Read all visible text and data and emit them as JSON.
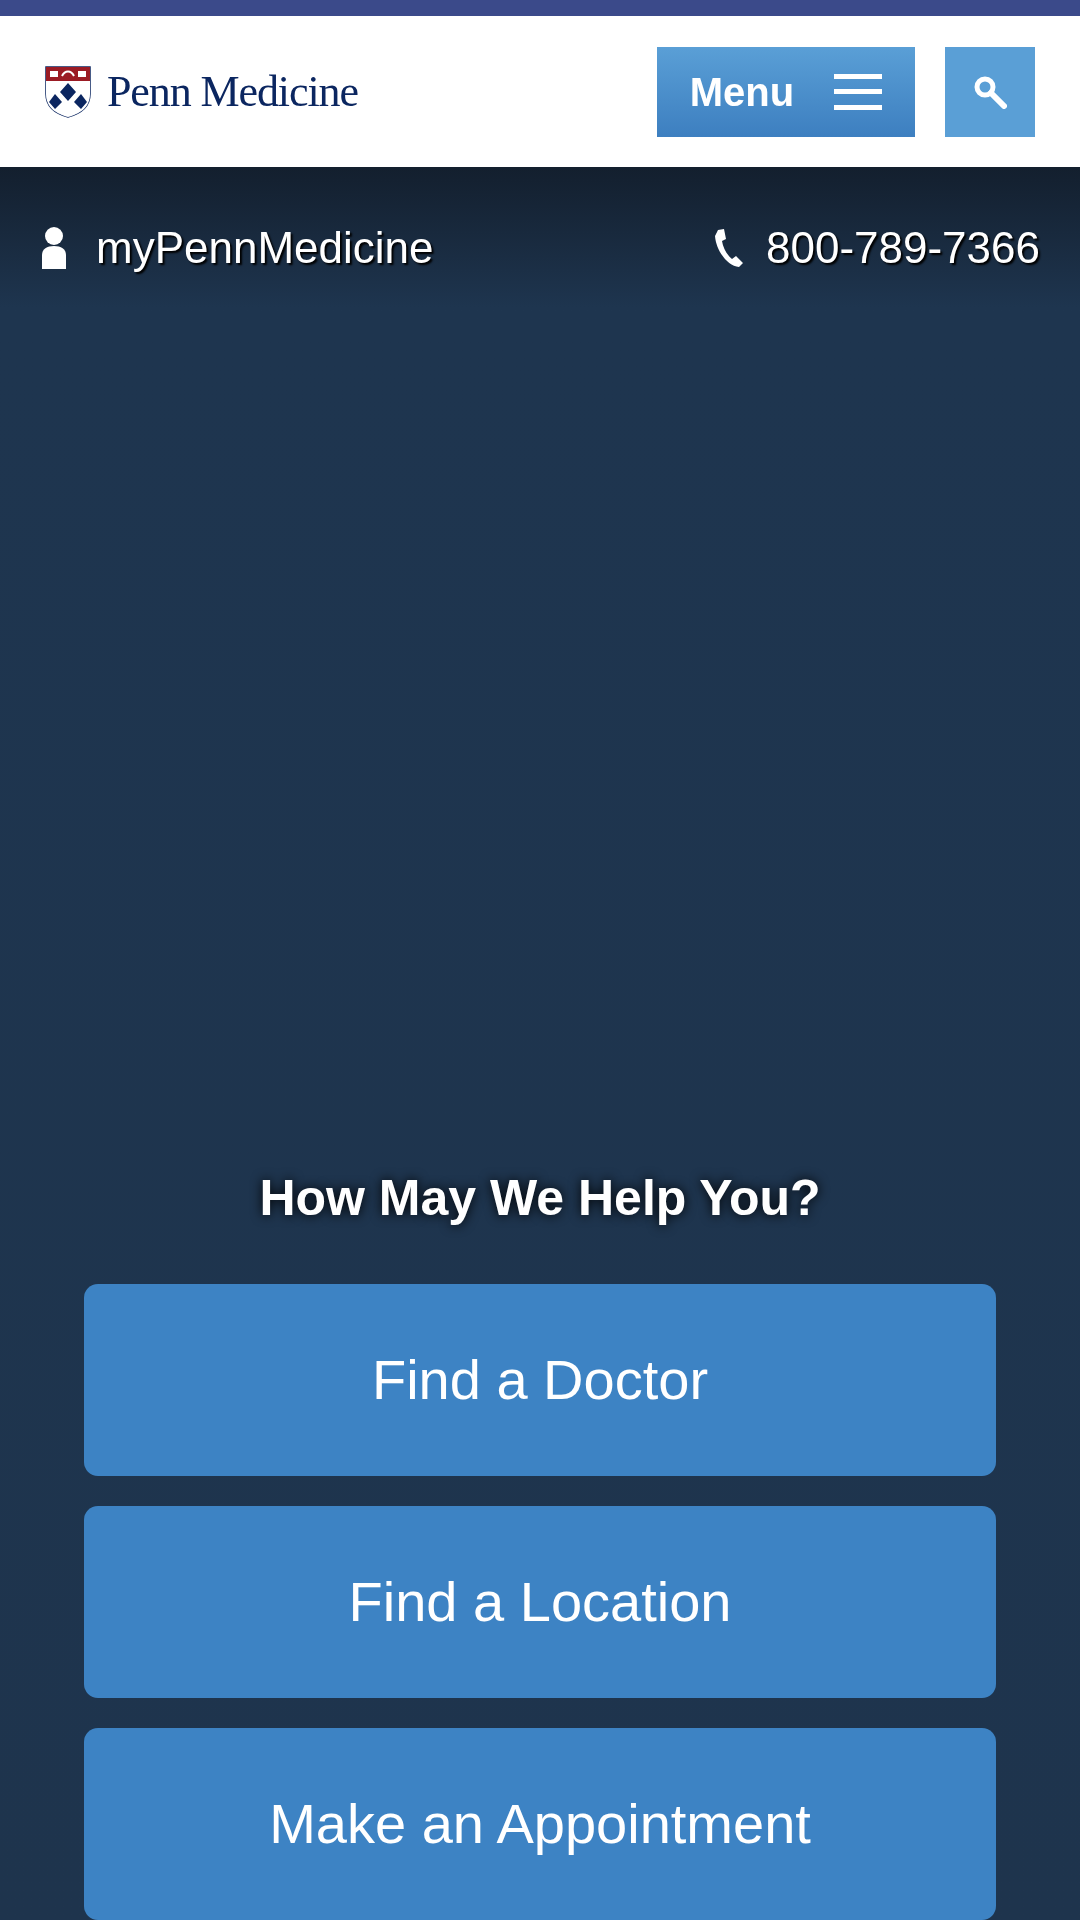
{
  "header": {
    "logo_text": "Penn Medicine",
    "menu_button": "Menu"
  },
  "utility_bar": {
    "account_link": "myPennMedicine",
    "phone": "800-789-7366"
  },
  "help": {
    "heading": "How May We Help You?",
    "buttons": [
      "Find a Doctor",
      "Find a Location",
      "Make an Appointment"
    ]
  }
}
